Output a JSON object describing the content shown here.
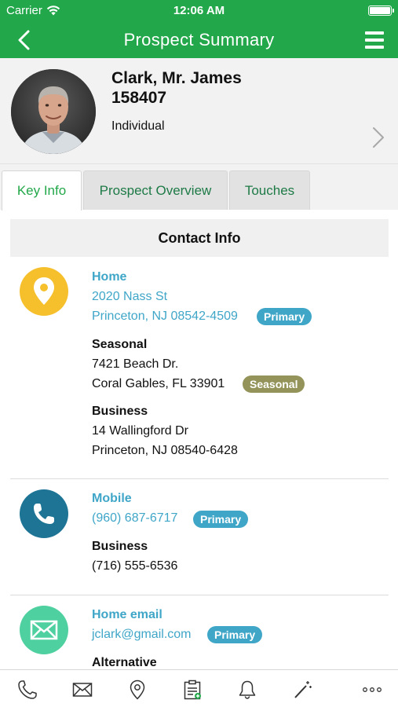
{
  "status_bar": {
    "carrier": "Carrier",
    "time": "12:06 AM"
  },
  "nav": {
    "title": "Prospect Summary"
  },
  "profile": {
    "name": "Clark, Mr. James",
    "id": "158407",
    "type": "Individual"
  },
  "tabs": [
    {
      "label": "Key Info",
      "active": true
    },
    {
      "label": "Prospect Overview",
      "active": false
    },
    {
      "label": "Touches",
      "active": false
    }
  ],
  "contact_info": {
    "heading": "Contact Info",
    "addresses": [
      {
        "label": "Home",
        "line1": "2020 Nass St",
        "line2": "Princeton, NJ 08542-4509",
        "badge": "Primary"
      },
      {
        "label": "Seasonal",
        "line1": "7421 Beach Dr.",
        "line2": "Coral Gables, FL 33901",
        "badge": "Seasonal"
      },
      {
        "label": "Business",
        "line1": "14 Wallingford Dr",
        "line2": "Princeton, NJ 08540-6428"
      }
    ],
    "phones": [
      {
        "label": "Mobile",
        "value": "(960) 687-6717",
        "badge": "Primary"
      },
      {
        "label": "Business",
        "value": "(716) 555-6536"
      }
    ],
    "emails": [
      {
        "label": "Home email",
        "value": "jclark@gmail.com",
        "badge": "Primary"
      },
      {
        "label": "Alternative"
      }
    ]
  },
  "colors": {
    "brand_green": "#22a84a",
    "link_blue": "#3fa6c8",
    "location_yellow": "#f6c02d",
    "phone_teal": "#1d7495",
    "email_mint": "#4fd0a0",
    "seasonal_olive": "#93935a"
  },
  "toolbar": {
    "icons": [
      "phone-icon",
      "mail-icon",
      "location-pin-icon",
      "clipboard-icon",
      "bell-icon",
      "magic-wand-icon",
      "more-icon"
    ]
  }
}
